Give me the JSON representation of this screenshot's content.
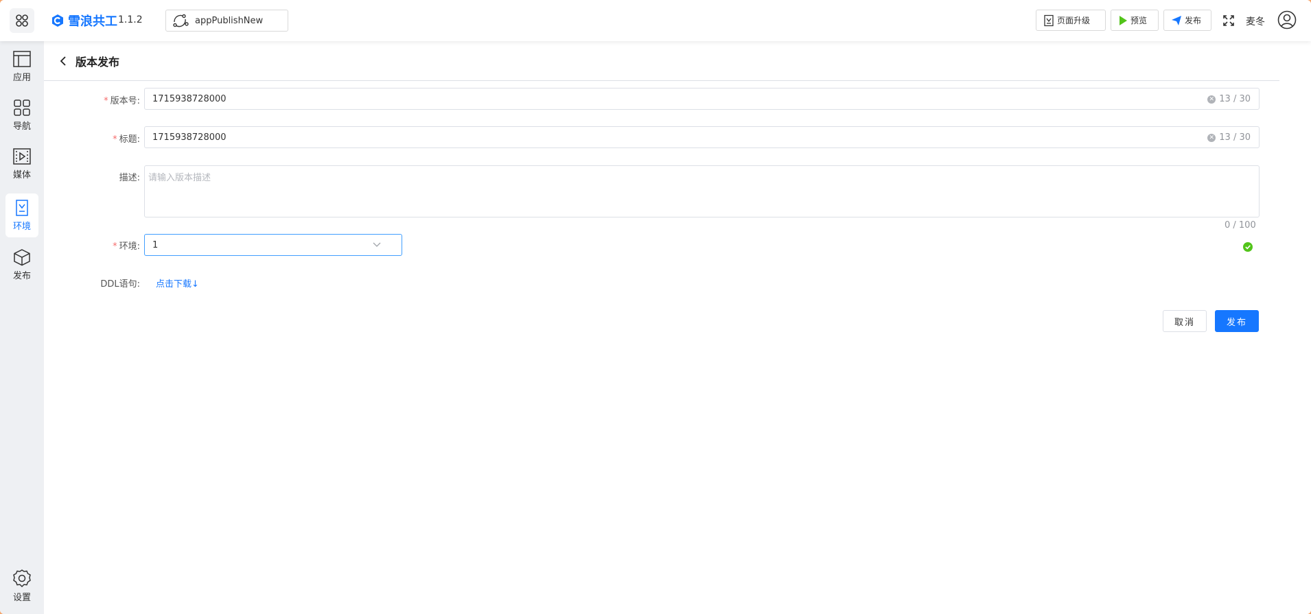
{
  "topbar": {
    "brand": "雪浪共工",
    "version": "1.1.2",
    "app_name": "appPublishNew",
    "upgrade_label": "页面升级",
    "preview_label": "预览",
    "publish_label": "发布",
    "username": "麦冬"
  },
  "sidebar": {
    "items": [
      {
        "label": "应用",
        "icon": "layout-icon"
      },
      {
        "label": "导航",
        "icon": "grid-icon"
      },
      {
        "label": "媒体",
        "icon": "media-icon"
      },
      {
        "label": "环境",
        "icon": "env-icon",
        "active": true
      },
      {
        "label": "发布",
        "icon": "box-icon"
      }
    ],
    "settings_label": "设置"
  },
  "page": {
    "title": "版本发布"
  },
  "form": {
    "version_label": "版本号:",
    "version_value": "1715938728000",
    "version_count": "13 / 30",
    "title_label": "标题:",
    "title_value": "1715938728000",
    "title_count": "13 / 30",
    "desc_label": "描述:",
    "desc_placeholder": "请输入版本描述",
    "desc_count": "0 / 100",
    "env_label": "环境:",
    "env_value": "1",
    "ddl_label": "DDL语句:",
    "ddl_link": "点击下载↓",
    "cancel_label": "取消",
    "submit_label": "发布"
  },
  "colors": {
    "accent": "#1677ff",
    "required": "#f56c6c",
    "success": "#52c41a"
  }
}
